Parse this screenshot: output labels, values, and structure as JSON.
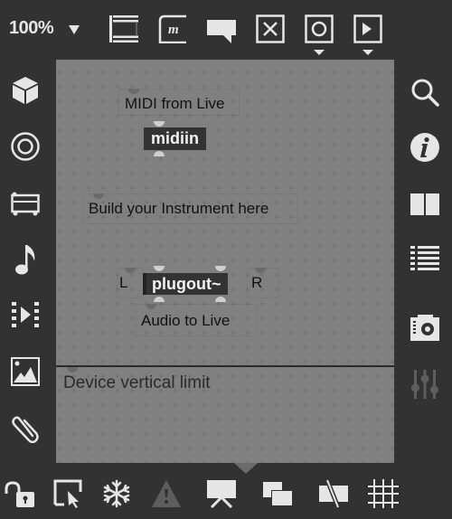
{
  "toolbar": {
    "zoom_level": "100%",
    "icons": [
      "presentation-layout-icon",
      "max-object-icon",
      "comment-icon",
      "toggle-x-icon",
      "button-circle-icon",
      "play-icon"
    ]
  },
  "left_sidebar": {
    "icons": [
      "package-cube-icon",
      "target-circle-icon",
      "device-rack-icon",
      "music-note-icon",
      "media-play-icon",
      "image-icon",
      "paperclip-icon"
    ]
  },
  "right_sidebar": {
    "icons": [
      "search-icon",
      "info-icon",
      "split-view-icon",
      "list-icon",
      "snapshot-camera-icon",
      "mixer-sliders-icon"
    ]
  },
  "canvas": {
    "comments": {
      "midi_from_live": "MIDI from Live",
      "build_instrument": "Build your Instrument here",
      "left": "L",
      "right": "R",
      "audio_to_live": "Audio to Live",
      "device_vertical_limit": "Device vertical limit"
    },
    "objects": {
      "midiin": "midiin",
      "plugout": "plugout~"
    }
  },
  "bottom_toolbar": {
    "icons": [
      "unlock-icon",
      "select-arrow-icon",
      "freeze-snowflake-icon",
      "warning-icon",
      "presentation-icon",
      "windows-icon",
      "no-patch-cords-icon",
      "grid-icon"
    ]
  },
  "colors": {
    "background": "#323232",
    "canvas": "#808080",
    "icon": "#e6e6e6",
    "object_box": "#333333"
  }
}
